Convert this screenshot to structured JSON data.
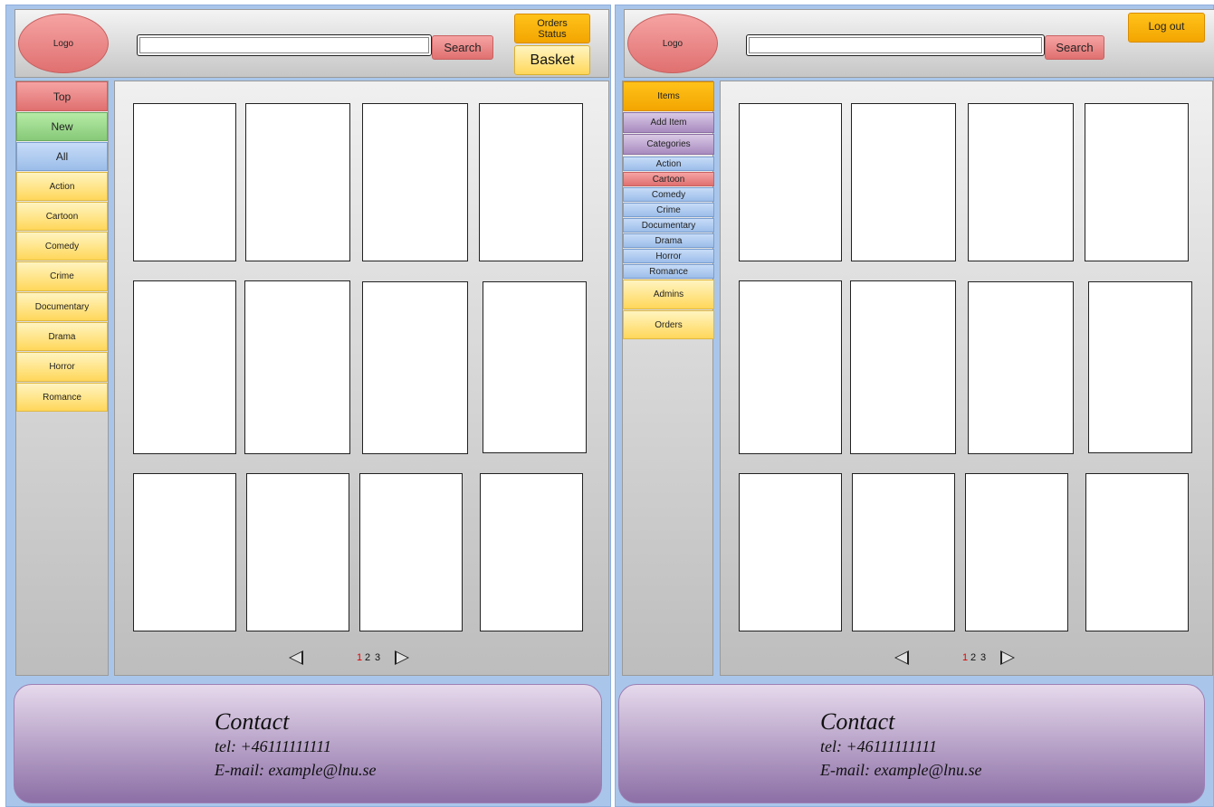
{
  "customer_view": {
    "header": {
      "logo": "Logo",
      "search_value": "",
      "search_button": "Search",
      "orders_status_line1": "Orders",
      "orders_status_line2": "Status",
      "basket_button": "Basket"
    },
    "sidebar": {
      "top": "Top",
      "new": "New",
      "all": "All",
      "categories": [
        "Action",
        "Cartoon",
        "Comedy",
        "Crime",
        "Documentary",
        "Drama",
        "Horror",
        "Romance"
      ]
    },
    "pager": {
      "pages": [
        "1",
        "2",
        "3"
      ],
      "current_page": "1"
    }
  },
  "admin_view": {
    "header": {
      "logo": "Logo",
      "search_value": "",
      "search_button": "Search",
      "logout_button": "Log out"
    },
    "sidebar": {
      "items": "Items",
      "add_item": "Add Item",
      "categories_label": "Categories",
      "categories": [
        "Action",
        "Cartoon",
        "Comedy",
        "Crime",
        "Documentary",
        "Drama",
        "Horror",
        "Romance"
      ],
      "selected_category": "Cartoon",
      "admins": "Admins",
      "orders": "Orders"
    },
    "pager": {
      "pages": [
        "1",
        "2",
        "3"
      ],
      "current_page": "1"
    }
  },
  "footer": {
    "title": "Contact",
    "tel": "tel: +46111111111",
    "email": "E-mail: example@lnu.se"
  },
  "colors": {
    "panel_bg": "#a9c6ea",
    "red_button": "#e07070",
    "green_button": "#86c978",
    "blue_button": "#9cbde9",
    "yellow_button": "#ffd75a",
    "orange_button": "#f3a500",
    "purple_button": "#a88bbf",
    "current_page": "#e00000"
  }
}
